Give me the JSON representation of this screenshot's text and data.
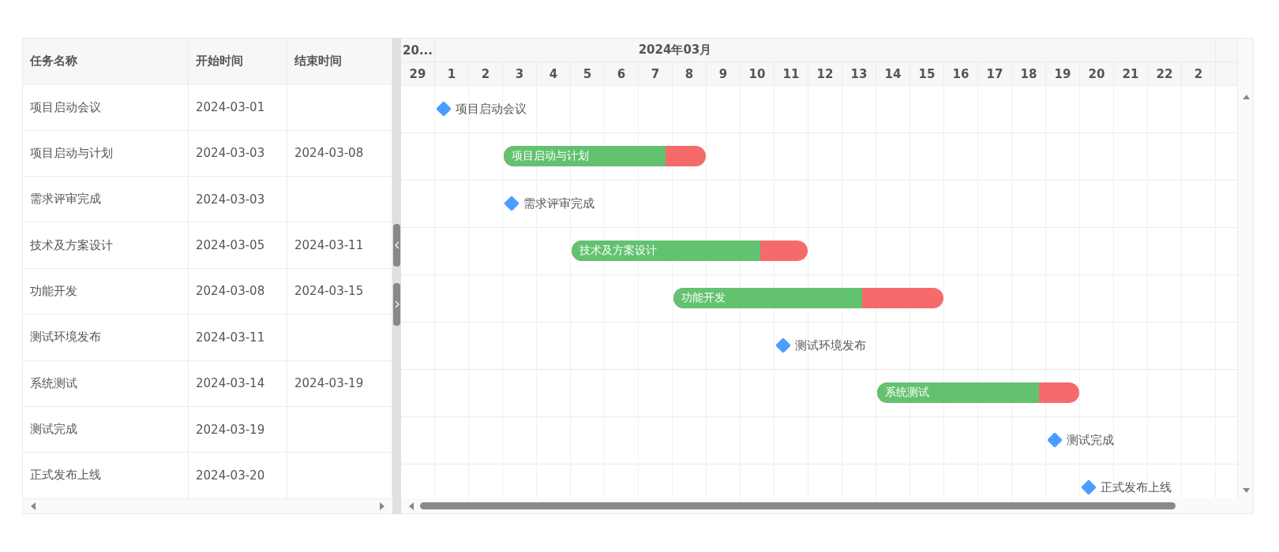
{
  "table": {
    "columns": [
      "任务名称",
      "开始时间",
      "结束时间"
    ],
    "rows": [
      {
        "kind": "milestone",
        "name": "项目启动会议",
        "start": "2024-03-01",
        "chart_label": "项目启动会议"
      },
      {
        "kind": "task",
        "name": "项目启动与计划",
        "start": "2024-03-03",
        "end": "2024-03-08",
        "level": 0.8,
        "chart_label": "项目启动与计划"
      },
      {
        "kind": "milestone",
        "name": "需求评审完成",
        "start": "2024-03-03",
        "chart_label": "需求评审完成"
      },
      {
        "kind": "task",
        "name": "技术及方案设计",
        "start": "2024-03-05",
        "end": "2024-03-11",
        "level": 0.8,
        "chart_label": "技术及方案设计"
      },
      {
        "kind": "task",
        "name": "功能开发",
        "start": "2024-03-08",
        "end": "2024-03-15",
        "level": 0.7,
        "chart_label": "功能开发"
      },
      {
        "kind": "milestone",
        "name": "测试环境发布",
        "start": "2024-03-11",
        "chart_label": "测试环境发布"
      },
      {
        "kind": "task",
        "name": "系统测试",
        "start": "2024-03-14",
        "end": "2024-03-19",
        "level": 0.8,
        "chart_label": "系统测试"
      },
      {
        "kind": "milestone",
        "name": "测试完成",
        "start": "2024-03-19",
        "chart_label": "测试完成"
      },
      {
        "kind": "milestone",
        "name": "正式发布上线",
        "start": "2024-03-20",
        "chart_label": "正式发布上线"
      }
    ]
  },
  "timeline": {
    "months": [
      {
        "label": "20...",
        "days": [
          "29"
        ]
      },
      {
        "label": "2024年03月",
        "days": [
          "1",
          "2",
          "3",
          "4",
          "5",
          "6",
          "7",
          "8",
          "9",
          "10",
          "11",
          "12",
          "13",
          "14",
          "15",
          "16",
          "17",
          "18",
          "19",
          "20",
          "21",
          "22",
          "2"
        ]
      }
    ]
  }
}
